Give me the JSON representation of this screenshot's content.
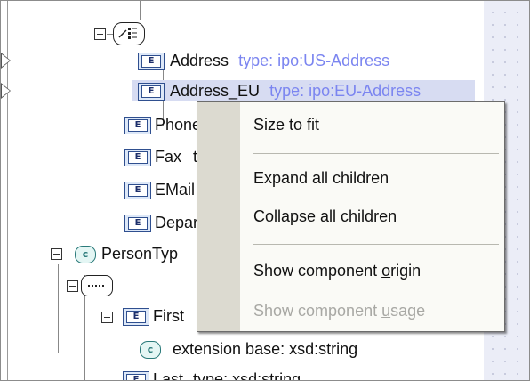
{
  "tree": {
    "items": [
      {
        "name": "Address",
        "type": "type: ipo:US-Address"
      },
      {
        "name": "Address_EU",
        "type": "type: ipo:EU-Address"
      },
      {
        "name": "Phone"
      },
      {
        "name": "Fax",
        "partial": "t"
      },
      {
        "name": "EMail"
      },
      {
        "name": "Depar"
      },
      {
        "name": "PersonTyp"
      },
      {
        "name": "First"
      },
      {
        "name": "extension base: xsd:string"
      },
      {
        "name": "Last",
        "type": "type: xsd:string"
      }
    ],
    "element_badge": "E",
    "complex_badge": "c"
  },
  "context_menu": {
    "items": [
      {
        "label": "Size to fit",
        "enabled": true
      },
      {
        "label": "Expand all children",
        "enabled": true
      },
      {
        "label": "Collapse all children",
        "enabled": true
      },
      {
        "label": "Show component ",
        "underline": "o",
        "rest": "rigin",
        "enabled": true
      },
      {
        "label": "Show component ",
        "underline": "u",
        "rest": "sage",
        "enabled": false
      }
    ]
  },
  "colors": {
    "type_text": "#7b85f0",
    "highlight": "#d7dcf2",
    "menu_bg": "#fafaf6",
    "menu_stripe": "#dcdad0",
    "disabled_text": "#a8a8a4"
  }
}
